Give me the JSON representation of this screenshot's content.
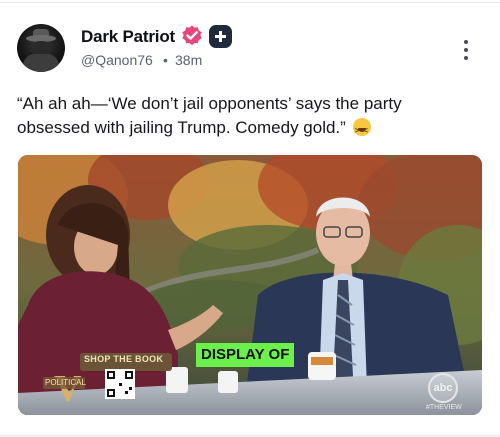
{
  "post": {
    "author_name": "Dark Patriot",
    "handle": "@Qanon76",
    "separator": "•",
    "time": "38m",
    "text": "“Ah ah ah—‘We don’t jail opponents’ says the party obsessed with jailing Trump. Comedy gold.”",
    "emoji": "laughing-squinting-face-emoji",
    "verified_color": "#e8477a",
    "badge_color": "#1f2a3c"
  },
  "media": {
    "shop_label": "SHOP THE BOOK",
    "overlay_text": "DISPLAY OF",
    "overlay_color": "#6cf04c",
    "brand_small": "POLITICAL",
    "brand_letter": "V",
    "network_logo": "abc",
    "network_tag": "#THEVIEW"
  }
}
